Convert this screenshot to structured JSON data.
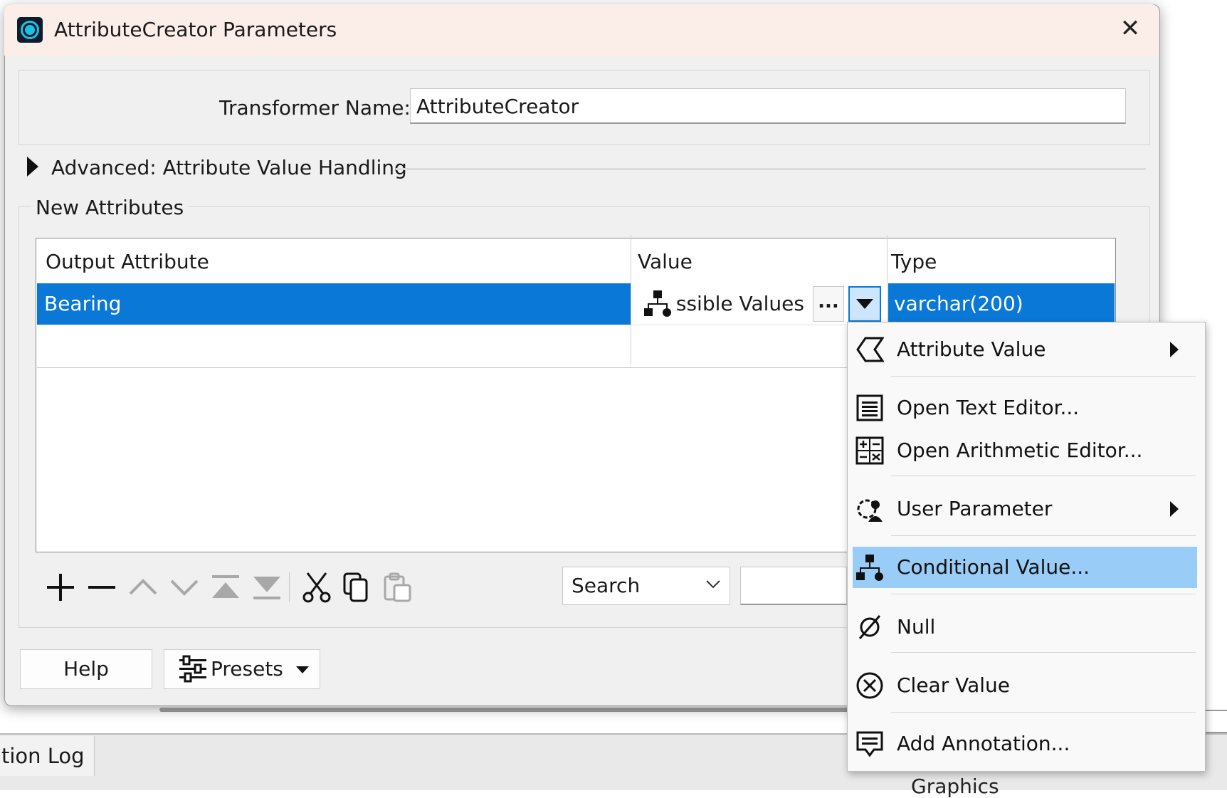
{
  "dialog": {
    "title": "AttributeCreator Parameters",
    "close_glyph": "✕",
    "transformer_name_label": "Transformer Name:",
    "transformer_name_value": "AttributeCreator",
    "advanced_label": "Advanced: Attribute Value Handling",
    "group_label": "New Attributes"
  },
  "table": {
    "columns": [
      "Output Attribute",
      "Value",
      "Type"
    ],
    "rows": [
      {
        "output_attribute": "Bearing",
        "value": "Possible Values",
        "type": "varchar(200)"
      }
    ],
    "ellipsis_label": "..."
  },
  "toolbar": {
    "icons": [
      "add-icon",
      "remove-icon",
      "move-up-icon",
      "move-down-icon",
      "move-top-icon",
      "move-bottom-icon",
      "cut-icon",
      "copy-icon",
      "paste-icon"
    ],
    "search_option": "Search"
  },
  "footer": {
    "help_label": "Help",
    "presets_label": "Presets"
  },
  "context_menu": {
    "items": [
      {
        "label": "Attribute Value",
        "icon": "attribute-value-icon",
        "submenu": true
      },
      {
        "label": "Open Text Editor...",
        "icon": "text-editor-icon",
        "submenu": false
      },
      {
        "label": "Open Arithmetic Editor...",
        "icon": "arithmetic-editor-icon",
        "submenu": false
      },
      {
        "label": "User Parameter",
        "icon": "user-parameter-icon",
        "submenu": true
      },
      {
        "label": "Conditional Value...",
        "icon": "conditional-value-icon",
        "submenu": false,
        "highlighted": true
      },
      {
        "label": "Null",
        "icon": "null-icon",
        "submenu": false
      },
      {
        "label": "Clear Value",
        "icon": "clear-value-icon",
        "submenu": false
      },
      {
        "label": "Add Annotation...",
        "icon": "annotation-icon",
        "submenu": false
      }
    ]
  },
  "background": {
    "tab_label": "tion Log",
    "partial_text": "Graphics"
  },
  "colors": {
    "selection": "#0a78d7",
    "menu_highlight": "#99cdf7",
    "titlebar": "#fbeee8"
  }
}
